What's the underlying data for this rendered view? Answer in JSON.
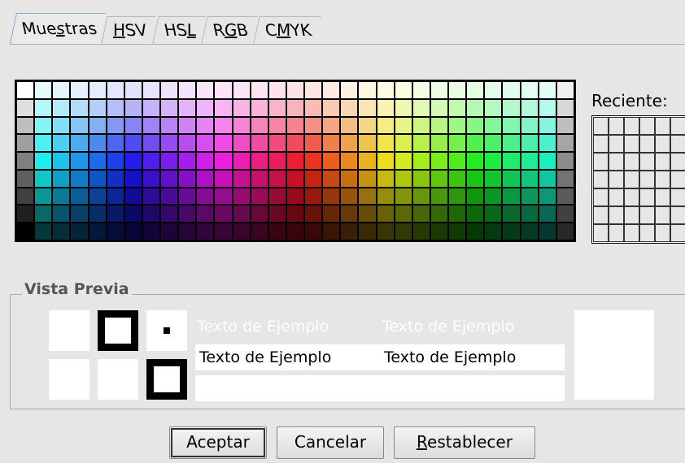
{
  "tabs": [
    {
      "label_pre": "Mue",
      "label_ul": "s",
      "label_post": "tras"
    },
    {
      "label_pre": "",
      "label_ul": "H",
      "label_post": "SV"
    },
    {
      "label_pre": "HS",
      "label_ul": "L",
      "label_post": ""
    },
    {
      "label_pre": "R",
      "label_ul": "G",
      "label_post": "B"
    },
    {
      "label_pre": "C",
      "label_ul": "M",
      "label_post": "YK"
    }
  ],
  "recent": {
    "label": "Reciente:"
  },
  "preview": {
    "title": "Vista Previa",
    "sample_text": "Texto de Ejemplo"
  },
  "buttons": {
    "accept": "Aceptar",
    "cancel": "Cancelar",
    "reset_ul": "R",
    "reset_post": "establecer"
  }
}
